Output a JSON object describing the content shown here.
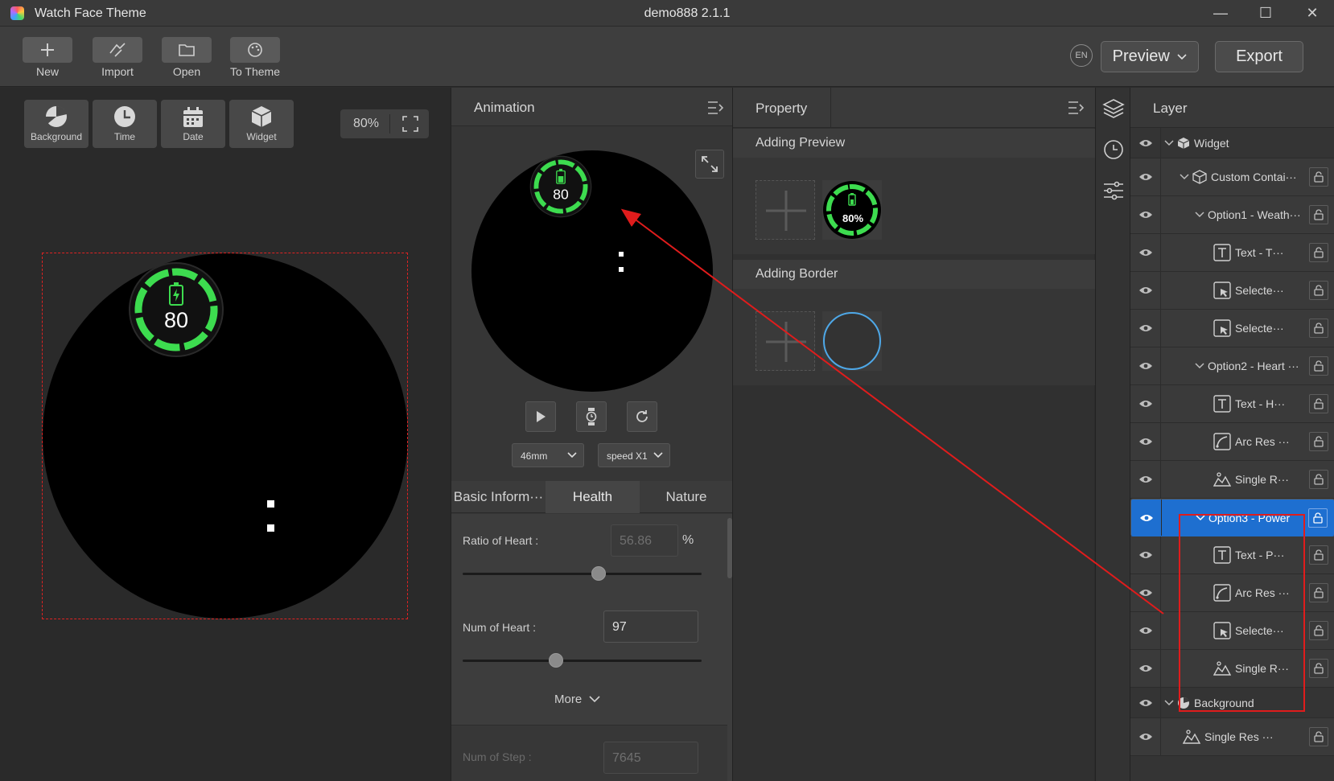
{
  "window": {
    "app_title": "Watch Face Theme",
    "doc_title": "demo888 2.1.1",
    "controls": [
      "minimize",
      "maximize",
      "close"
    ]
  },
  "toolbar": {
    "new_label": "New",
    "import_label": "Import",
    "open_label": "Open",
    "to_theme_label": "To Theme",
    "lang": "EN",
    "preview_label": "Preview",
    "export_label": "Export"
  },
  "canvas": {
    "tools": {
      "background": "Background",
      "time": "Time",
      "date": "Date",
      "widget": "Widget"
    },
    "zoom": "80%",
    "battery_value": "80"
  },
  "animation": {
    "title": "Animation",
    "battery_value": "80",
    "size_select": "46mm",
    "speed_select": "speed X1",
    "tabs": [
      "Basic Inform···",
      "Health",
      "Nature"
    ],
    "active_tab": 1,
    "fields": {
      "ratio_label": "Ratio of Heart :",
      "ratio_value": "56.86",
      "ratio_unit": "%",
      "ratio_slider": 0.57,
      "num_heart_label": "Num of Heart :",
      "num_heart_value": "97",
      "num_heart_slider": 0.39,
      "more_label": "More",
      "num_step_label": "Num of Step :",
      "num_step_value": "7645"
    }
  },
  "property": {
    "title": "Property",
    "adding_preview": "Adding Preview",
    "preview_badge": "80%",
    "adding_border": "Adding Border"
  },
  "layer": {
    "title": "Layer",
    "rows": [
      {
        "name": "Widget",
        "icon": "widget-cube-icon",
        "chevron": true,
        "eye": true,
        "lock": false
      },
      {
        "name": "Custom Contai···",
        "icon": "container-box-icon",
        "chevron": true,
        "eye": true,
        "lock": true
      },
      {
        "name": "Option1 - Weath···",
        "icon": "",
        "chevron": true,
        "eye": true,
        "lock": true
      },
      {
        "name": "Text - T···",
        "icon": "text-icon",
        "chevron": false,
        "eye": true,
        "lock": true
      },
      {
        "name": "Selecte···",
        "icon": "selected-image-icon",
        "chevron": false,
        "eye": true,
        "lock": true
      },
      {
        "name": "Selecte···",
        "icon": "selected-image-icon",
        "chevron": false,
        "eye": true,
        "lock": true
      },
      {
        "name": "Option2 - Heart ···",
        "icon": "",
        "chevron": true,
        "eye": true,
        "lock": true
      },
      {
        "name": "Text - H···",
        "icon": "text-icon",
        "chevron": false,
        "eye": true,
        "lock": true
      },
      {
        "name": "Arc Res ···",
        "icon": "arc-icon",
        "chevron": false,
        "eye": true,
        "lock": true
      },
      {
        "name": "Single R···",
        "icon": "image-icon",
        "chevron": false,
        "eye": true,
        "lock": true
      },
      {
        "name": "Option3 - Power",
        "icon": "",
        "chevron": true,
        "eye": true,
        "lock": true,
        "selected": true
      },
      {
        "name": "Text - P···",
        "icon": "text-icon",
        "chevron": false,
        "eye": true,
        "lock": true
      },
      {
        "name": "Arc Res ···",
        "icon": "arc-icon",
        "chevron": false,
        "eye": true,
        "lock": true
      },
      {
        "name": "Selecte···",
        "icon": "selected-image-icon",
        "chevron": false,
        "eye": true,
        "lock": true
      },
      {
        "name": "Single R···",
        "icon": "image-icon",
        "chevron": false,
        "eye": true,
        "lock": true
      },
      {
        "name": "Background",
        "icon": "background-icon",
        "chevron": true,
        "eye": true,
        "lock": false
      },
      {
        "name": "Single Res ···",
        "icon": "image-icon",
        "chevron": false,
        "eye": true,
        "lock": true
      }
    ]
  },
  "colors": {
    "accent": "#1e6fd0",
    "battery_green": "#3ddc4f",
    "annotation_red": "#e01c1c",
    "border_preview_blue": "#4ea8e8"
  }
}
